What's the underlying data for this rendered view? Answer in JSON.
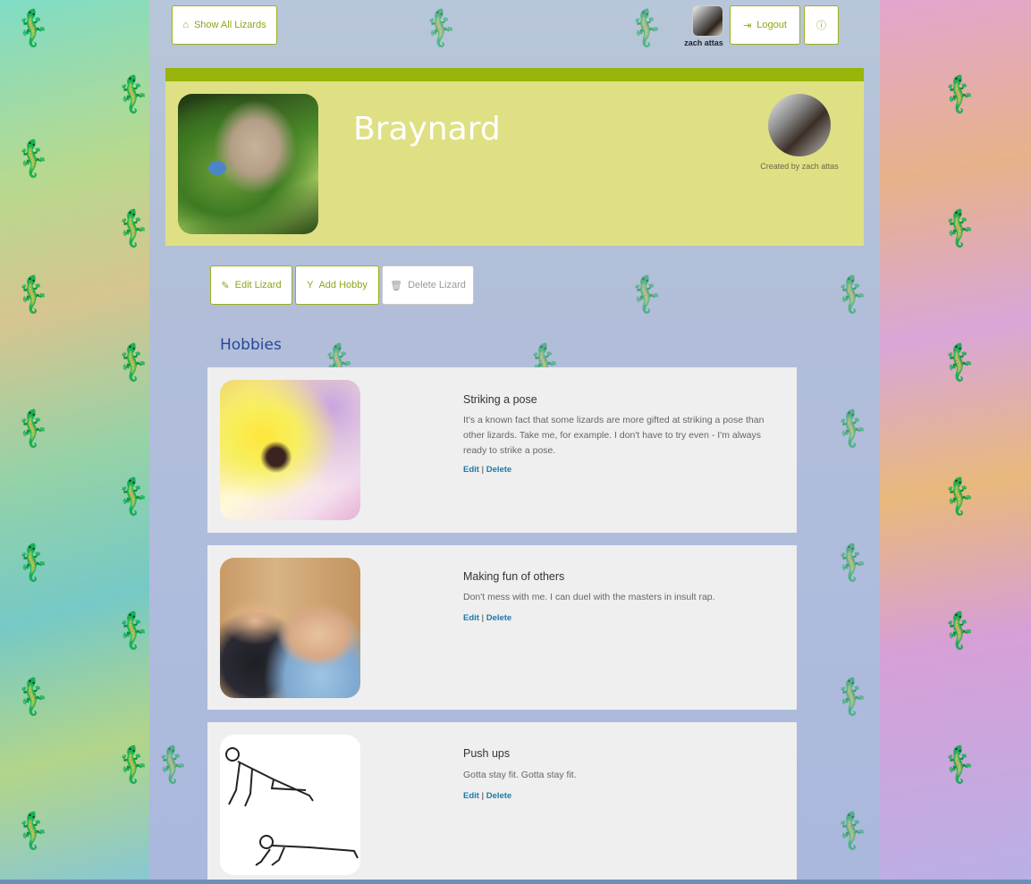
{
  "nav": {
    "show_all_label": "Show All Lizards",
    "logout_label": "Logout",
    "user_name": "zach attas"
  },
  "lizard": {
    "name": "Braynard",
    "created_by": "Created by zach attas"
  },
  "actions": {
    "edit_label": "Edit Lizard",
    "add_hobby_label": "Add Hobby",
    "delete_label": "Delete Lizard"
  },
  "hobbies_title": "Hobbies",
  "hobbies": [
    {
      "name": "Striking a pose",
      "description": "It's a known fact that some lizards are more gifted at striking a pose than other lizards. Take me, for example. I don't have to try even - I'm always ready to strike a pose.",
      "edit": "Edit",
      "delete": "Delete"
    },
    {
      "name": "Making fun of others",
      "description": "Don't mess with me. I can duel with the masters in insult rap.",
      "edit": "Edit",
      "delete": "Delete"
    },
    {
      "name": "Push ups",
      "description": "Gotta stay fit. Gotta stay fit.",
      "edit": "Edit",
      "delete": "Delete"
    }
  ],
  "colors": {
    "accent": "#99b40a",
    "profile_bg": "#dfe083",
    "link": "#1f7aa8",
    "heading": "#27479a"
  }
}
